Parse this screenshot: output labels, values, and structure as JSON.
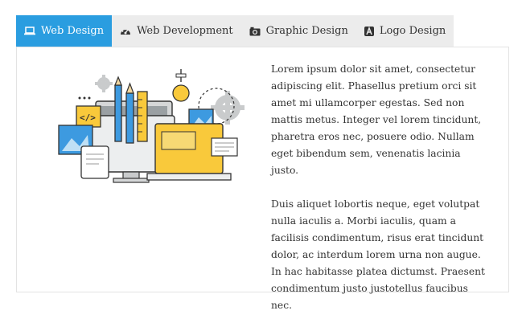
{
  "tabs": [
    {
      "label": "Web Design",
      "icon": "laptop-icon",
      "active": true
    },
    {
      "label": "Web Development",
      "icon": "dashboard-icon",
      "active": false
    },
    {
      "label": "Graphic Design",
      "icon": "camera-icon",
      "active": false
    },
    {
      "label": "Logo Design",
      "icon": "logo-a-icon",
      "active": false
    }
  ],
  "colors": {
    "accent": "#2a9de0",
    "tab_bg": "#ececec",
    "yellow": "#f9c93b",
    "blue": "#3d9ae0"
  },
  "content": {
    "paragraph_1": "Lorem ipsum dolor sit amet, consectetur adipiscing elit. Phasellus pretium orci sit amet mi ullamcorper egestas. Sed non mattis metus. Integer vel lorem tincidunt, pharetra eros nec, posuere odio. Nullam eget bibendum sem, venenatis lacinia justo.",
    "paragraph_2": "Duis aliquet lobortis neque, eget volutpat nulla iaculis a. Morbi iaculis, quam a facilisis condimentum, risus erat tincidunt dolor, ac interdum lorem urna non augue. In hac habitasse platea dictumst. Praesent condimentum justo justotellus faucibus nec."
  },
  "illustration": {
    "icon": "web-design-illustration"
  }
}
